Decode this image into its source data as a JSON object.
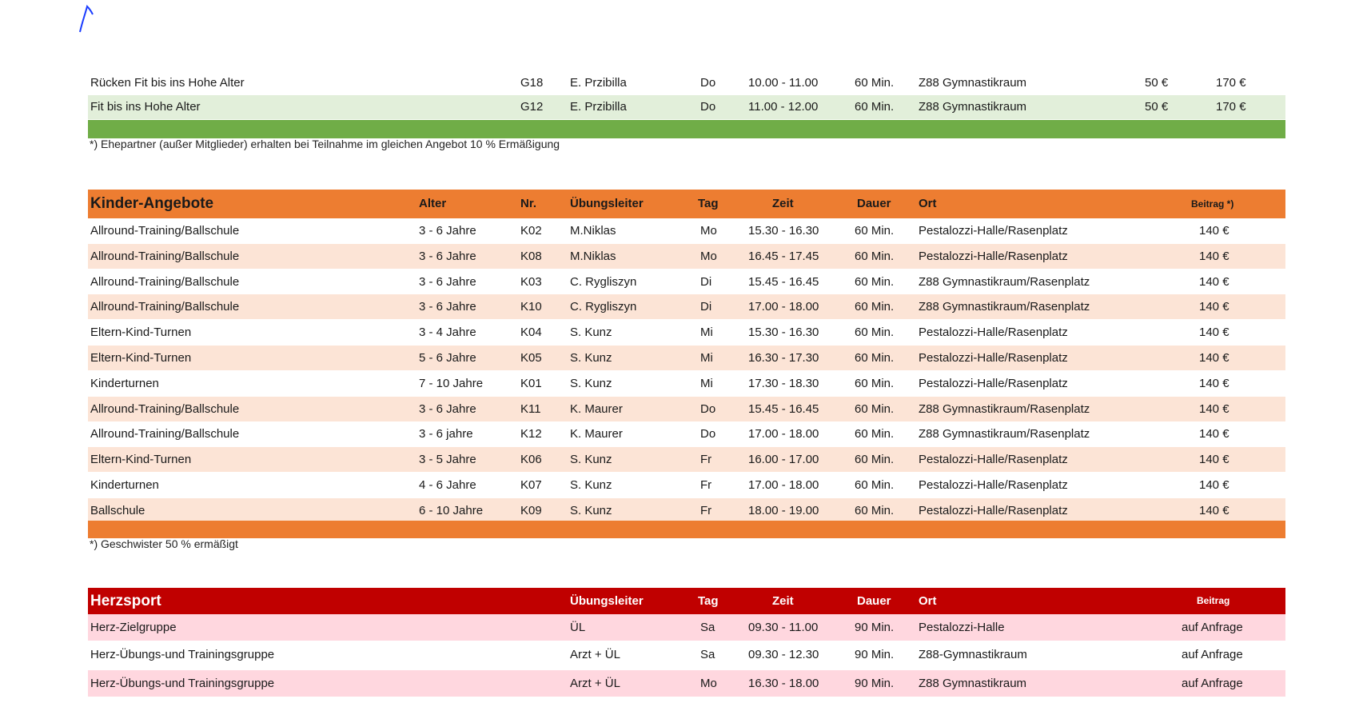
{
  "senior": {
    "rows": [
      {
        "name": "Rücken Fit bis ins Hohe Alter",
        "nr": "G18",
        "leader": "E. Przibilla",
        "day": "Do",
        "time": "10.00 - 11.00",
        "dur": "60 Min.",
        "place": "Z88 Gymnastikraum",
        "fee1": "50 €",
        "fee2": "170 €"
      },
      {
        "name": "Fit bis ins Hohe Alter",
        "nr": "G12",
        "leader": "E. Przibilla",
        "day": "Do",
        "time": "11.00 - 12.00",
        "dur": "60 Min.",
        "place": "Z88 Gymnastikraum",
        "fee1": "50 €",
        "fee2": "170 €"
      }
    ],
    "note": "*) Ehepartner (außer Mitglieder) erhalten bei Teilnahme im gleichen Angebot 10 % Ermäßigung",
    "bar_color": "#70ad47",
    "stripe_color": "#e2efda"
  },
  "kids": {
    "header": {
      "title": "Kinder-Angebote",
      "age": "Alter",
      "nr": "Nr.",
      "leader": "Übungsleiter",
      "day": "Tag",
      "time": "Zeit",
      "dur": "Dauer",
      "place": "Ort",
      "fee": "Beitrag *)"
    },
    "rows": [
      {
        "name": "Allround-Training/Ballschule",
        "age": "3 - 6 Jahre",
        "nr": "K02",
        "leader": "M.Niklas",
        "day": "Mo",
        "time": "15.30 - 16.30",
        "dur": "60 Min.",
        "place": "Pestalozzi-Halle/Rasenplatz",
        "fee": "140 €"
      },
      {
        "name": "Allround-Training/Ballschule",
        "age": "3 - 6 Jahre",
        "nr": "K08",
        "leader": "M.Niklas",
        "day": "Mo",
        "time": "16.45 - 17.45",
        "dur": "60 Min.",
        "place": "Pestalozzi-Halle/Rasenplatz",
        "fee": "140 €"
      },
      {
        "name": "Allround-Training/Ballschule",
        "age": "3 - 6 Jahre",
        "nr": "K03",
        "leader": "C. Rygliszyn",
        "day": "Di",
        "time": "15.45 - 16.45",
        "dur": "60 Min.",
        "place": "Z88 Gymnastikraum/Rasenplatz",
        "fee": "140 €"
      },
      {
        "name": "Allround-Training/Ballschule",
        "age": "3 - 6 Jahre",
        "nr": "K10",
        "leader": "C. Rygliszyn",
        "day": "Di",
        "time": "17.00 - 18.00",
        "dur": "60 Min.",
        "place": "Z88 Gymnastikraum/Rasenplatz",
        "fee": "140 €"
      },
      {
        "name": "Eltern-Kind-Turnen",
        "age": "3 - 4 Jahre",
        "nr": "K04",
        "leader": "S. Kunz",
        "day": "Mi",
        "time": "15.30 - 16.30",
        "dur": "60 Min.",
        "place": "Pestalozzi-Halle/Rasenplatz",
        "fee": "140 €"
      },
      {
        "name": "Eltern-Kind-Turnen",
        "age": "5 - 6 Jahre",
        "nr": "K05",
        "leader": "S. Kunz",
        "day": "Mi",
        "time": "16.30 - 17.30",
        "dur": "60 Min.",
        "place": "Pestalozzi-Halle/Rasenplatz",
        "fee": "140 €"
      },
      {
        "name": "Kinderturnen",
        "age": "7 - 10 Jahre",
        "nr": "K01",
        "leader": "S. Kunz",
        "day": "Mi",
        "time": "17.30 - 18.30",
        "dur": "60 Min.",
        "place": "Pestalozzi-Halle/Rasenplatz",
        "fee": "140 €"
      },
      {
        "name": "Allround-Training/Ballschule",
        "age": "3 - 6 Jahre",
        "nr": "K11",
        "leader": "K. Maurer",
        "day": "Do",
        "time": "15.45 - 16.45",
        "dur": "60 Min.",
        "place": "Z88 Gymnastikraum/Rasenplatz",
        "fee": "140 €"
      },
      {
        "name": "Allround-Training/Ballschule",
        "age": "3 - 6 jahre",
        "nr": "K12",
        "leader": "K. Maurer",
        "day": "Do",
        "time": "17.00 - 18.00",
        "dur": "60 Min.",
        "place": "Z88 Gymnastikraum/Rasenplatz",
        "fee": "140 €"
      },
      {
        "name": "Eltern-Kind-Turnen",
        "age": "3 - 5 Jahre",
        "nr": "K06",
        "leader": "S. Kunz",
        "day": "Fr",
        "time": "16.00 - 17.00",
        "dur": "60 Min.",
        "place": "Pestalozzi-Halle/Rasenplatz",
        "fee": "140 €"
      },
      {
        "name": "Kinderturnen",
        "age": "4 - 6 Jahre",
        "nr": "K07",
        "leader": "S. Kunz",
        "day": "Fr",
        "time": "17.00 - 18.00",
        "dur": "60 Min.",
        "place": "Pestalozzi-Halle/Rasenplatz",
        "fee": "140 €"
      },
      {
        "name": "Ballschule",
        "age": "6 - 10 Jahre",
        "nr": "K09",
        "leader": "S. Kunz",
        "day": "Fr",
        "time": "18.00 - 19.00",
        "dur": "60 Min.",
        "place": "Pestalozzi-Halle/Rasenplatz",
        "fee": "140 €"
      }
    ],
    "note": "*)  Geschwister 50 % ermäßigt",
    "header_color": "#ed7d31",
    "stripe_color": "#fce4d6"
  },
  "herz": {
    "header": {
      "title": "Herzsport",
      "leader": "Übungsleiter",
      "day": "Tag",
      "time": "Zeit",
      "dur": "Dauer",
      "place": "Ort",
      "fee": "Beitrag"
    },
    "rows": [
      {
        "name": "Herz-Zielgruppe",
        "leader": "ÜL",
        "day": "Sa",
        "time": "09.30 - 11.00",
        "dur": "90 Min.",
        "place": "Pestalozzi-Halle",
        "fee": "auf Anfrage"
      },
      {
        "name": "Herz-Übungs-und Trainingsgruppe",
        "leader": "Arzt + ÜL",
        "day": "Sa",
        "time": "09.30 - 12.30",
        "dur": "90 Min.",
        "place": "Z88-Gymnastikraum",
        "fee": "auf Anfrage"
      },
      {
        "name": "Herz-Übungs-und Trainingsgruppe",
        "leader": "Arzt + ÜL",
        "day": "Mo",
        "time": "16.30 - 18.00",
        "dur": "90 Min.",
        "place": "Z88 Gymnastikraum",
        "fee": "auf Anfrage"
      }
    ],
    "header_color": "#c00000",
    "stripe_color": "#ffd7df"
  }
}
